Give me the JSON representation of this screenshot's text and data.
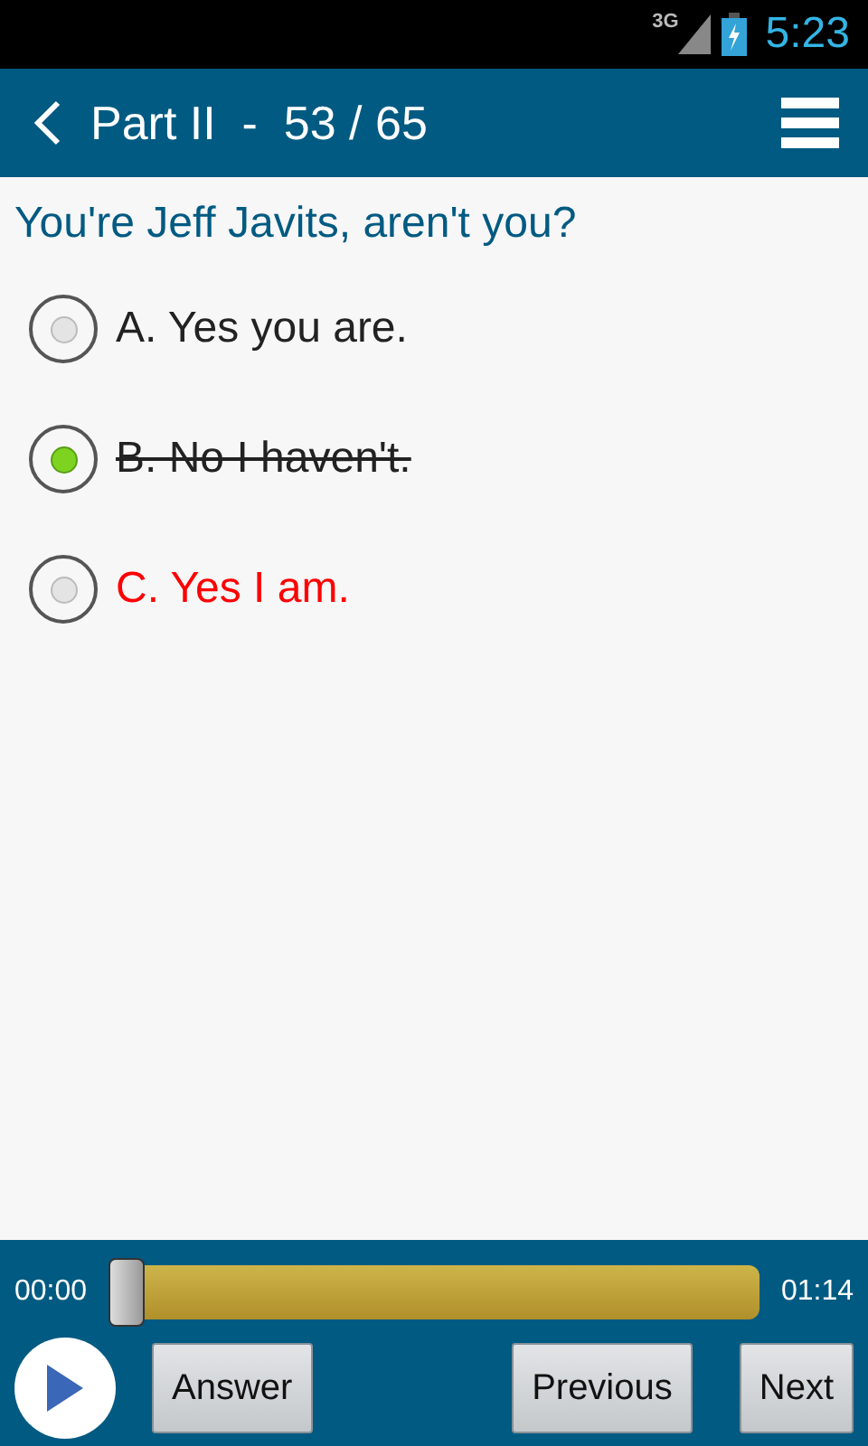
{
  "status_bar": {
    "network": "3G",
    "time": "5:23"
  },
  "header": {
    "title": "Part II  -  53 / 65"
  },
  "question": "You're Jeff Javits, aren't you?",
  "options": [
    {
      "label": "A. Yes you are.",
      "selected": false,
      "kind": "plain"
    },
    {
      "label": "B. No I haven't.",
      "selected": true,
      "kind": "struck"
    },
    {
      "label": "C. Yes I am.",
      "selected": false,
      "kind": "correct"
    }
  ],
  "player": {
    "elapsed": "00:00",
    "total": "01:14",
    "level": 0.0
  },
  "buttons": [
    {
      "label": "Answer",
      "kind": "left"
    },
    {
      "label": "Previous",
      "kind": "right"
    },
    {
      "label": "Next",
      "kind": "right"
    }
  ]
}
